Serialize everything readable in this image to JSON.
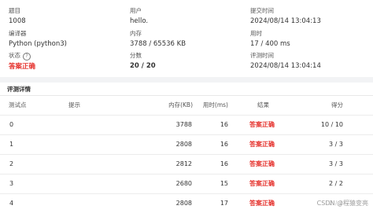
{
  "submission": {
    "problem_label": "题目",
    "problem_value": "1008",
    "user_label": "用户",
    "user_value": "hello.",
    "submit_time_label": "提交时间",
    "submit_time_value": "2024/08/14 13:04:13",
    "compiler_label": "编译器",
    "compiler_value": "Python (python3)",
    "memory_label": "内存",
    "memory_value": "3788 / 65536 KB",
    "time_label": "用时",
    "time_value": "17 / 400 ms",
    "status_label": "状态",
    "status_help_icon": "help-circle-icon",
    "status_value": "答案正确",
    "score_label": "分数",
    "score_value": "20 / 20",
    "judge_time_label": "评测时间",
    "judge_time_value": "2024/08/14 13:04:14"
  },
  "details": {
    "title": "评测详情",
    "columns": {
      "case": "测试点",
      "hint": "提示",
      "memory": "内存(KB)",
      "time": "用时(ms)",
      "result": "结果",
      "score": "得分"
    },
    "rows": [
      {
        "case": "0",
        "hint": "",
        "memory": "3788",
        "time": "16",
        "result": "答案正确",
        "score": "10 / 10"
      },
      {
        "case": "1",
        "hint": "",
        "memory": "2808",
        "time": "16",
        "result": "答案正确",
        "score": "3 / 3"
      },
      {
        "case": "2",
        "hint": "",
        "memory": "2812",
        "time": "16",
        "result": "答案正确",
        "score": "3 / 3"
      },
      {
        "case": "3",
        "hint": "",
        "memory": "2680",
        "time": "15",
        "result": "答案正确",
        "score": "2 / 2"
      },
      {
        "case": "4",
        "hint": "",
        "memory": "2808",
        "time": "17",
        "result": "答案正确",
        "score": "2 / 2"
      }
    ]
  },
  "colors": {
    "accepted": "#e5322d",
    "separator": "#f2f3f5"
  },
  "watermark": "CSDN @程猿变亮"
}
